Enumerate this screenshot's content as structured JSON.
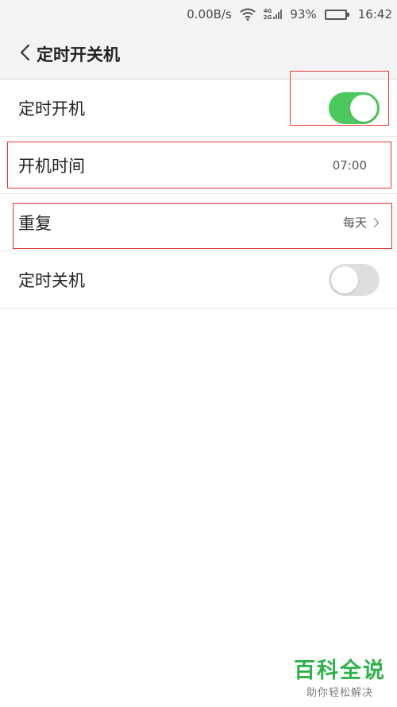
{
  "status_bar": {
    "speed": "0.00B/s",
    "network_top": "4G",
    "network_bottom": "2G",
    "battery_percent": "93%",
    "battery_level": 0.93,
    "time": "16:42"
  },
  "header": {
    "title": "定时开关机",
    "back_icon": "chevron-left-icon"
  },
  "settings": {
    "auto_power_on": {
      "label": "定时开机",
      "enabled": true
    },
    "power_on_time": {
      "label": "开机时间",
      "value": "07:00"
    },
    "repeat": {
      "label": "重复",
      "value": "每天",
      "icon": "chevron-right-icon"
    },
    "auto_power_off": {
      "label": "定时关机",
      "enabled": false
    }
  },
  "watermark": {
    "title": "百科全说",
    "subtitle": "助你轻松解决"
  },
  "colors": {
    "toggle_on": "#4cc85e",
    "toggle_off": "#dedede",
    "highlight": "#e53935",
    "watermark": "#2fb24c"
  }
}
